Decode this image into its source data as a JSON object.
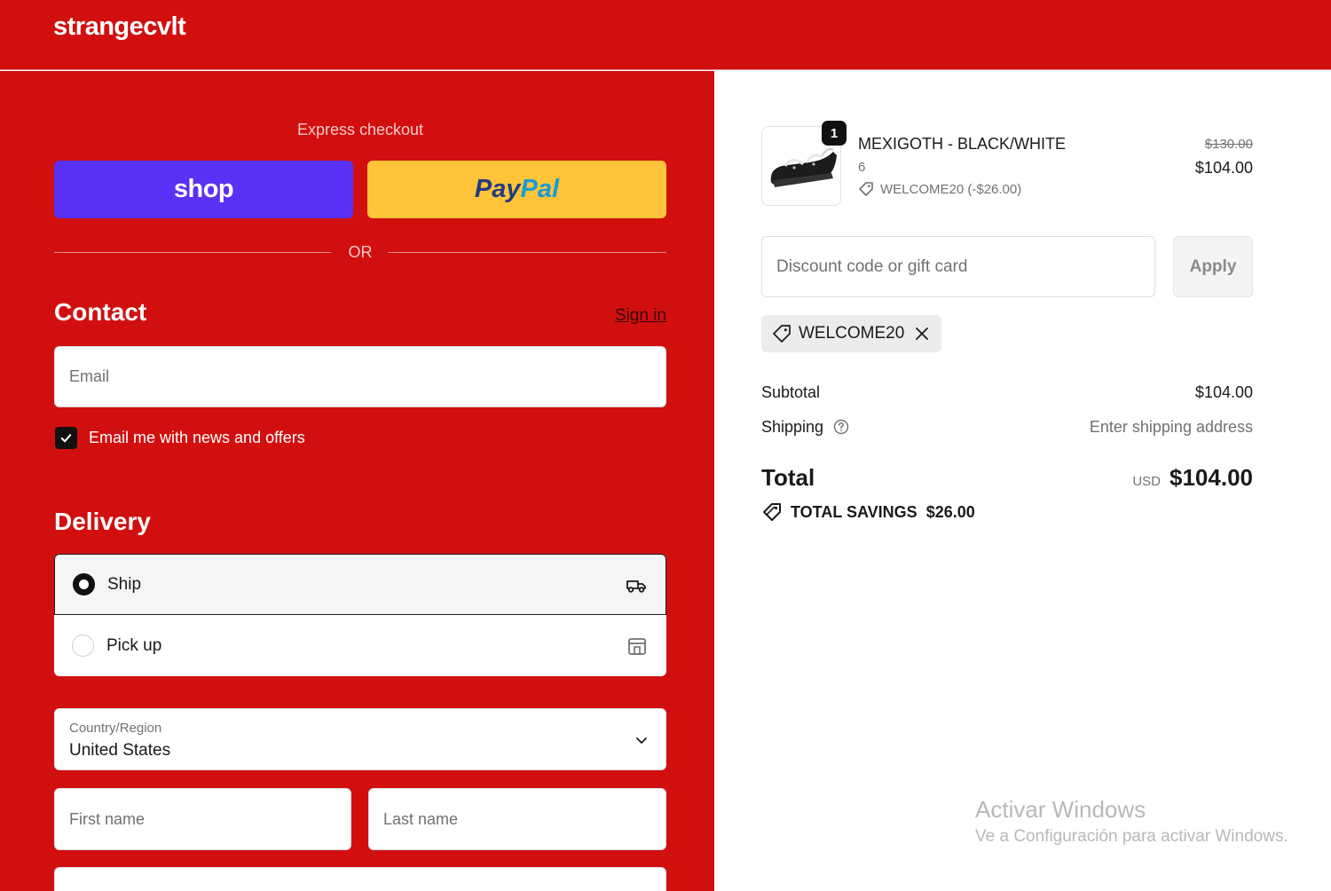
{
  "header": {
    "brand": "strangecvlt"
  },
  "checkout": {
    "express_label": "Express checkout",
    "shop_label": "shop",
    "paypal_part1": "Pay",
    "paypal_part2": "Pal",
    "or_label": "OR",
    "contact": {
      "title": "Contact",
      "signin_label": "Sign in",
      "email_placeholder": "Email",
      "newsletter_label": "Email me with news and offers",
      "newsletter_checked": true
    },
    "delivery": {
      "title": "Delivery",
      "options": [
        {
          "label": "Ship",
          "selected": true,
          "icon": "truck-icon"
        },
        {
          "label": "Pick up",
          "selected": false,
          "icon": "store-icon"
        }
      ],
      "country_label": "Country/Region",
      "country_value": "United States",
      "first_name_placeholder": "First name",
      "last_name_placeholder": "Last name"
    }
  },
  "order": {
    "item": {
      "quantity": "1",
      "name": "MEXIGOTH - BLACK/WHITE",
      "variant": "6",
      "discount": "WELCOME20 (-$26.00)",
      "price_original": "$130.00",
      "price": "$104.00"
    },
    "discount_placeholder": "Discount code or gift card",
    "apply_label": "Apply",
    "applied_code": "WELCOME20",
    "subtotal_label": "Subtotal",
    "subtotal_value": "$104.00",
    "shipping_label": "Shipping",
    "shipping_value": "Enter shipping address",
    "total_label": "Total",
    "total_currency": "USD",
    "total_value": "$104.00",
    "savings_label": "TOTAL SAVINGS",
    "savings_value": "$26.00"
  },
  "watermark": {
    "line1": "Activar Windows",
    "line2": "Ve a Configuración para activar Windows."
  },
  "colors": {
    "brand_red": "#d10f0f",
    "shop_purple": "#5a31f4",
    "paypal_yellow": "#ffc439"
  }
}
